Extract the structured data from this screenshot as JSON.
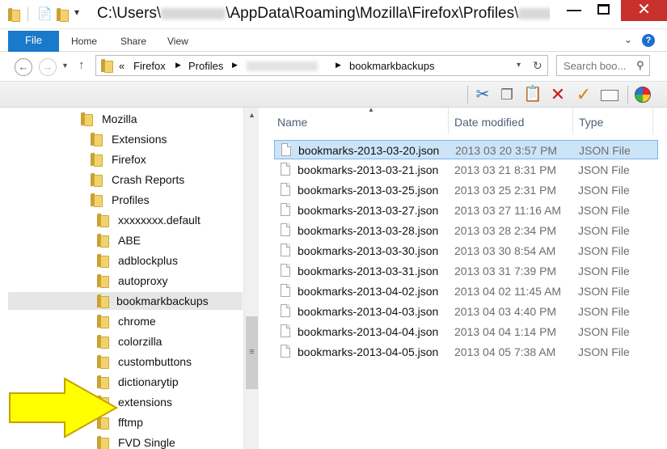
{
  "window": {
    "title": "C:\\Users\\",
    "title_rest": "\\AppData\\Roaming\\Mozilla\\Firefox\\Profiles\\",
    "close_glyph": "✕",
    "minimize_glyph": "—",
    "maximize_glyph": "☐"
  },
  "ribbon": {
    "file": "File",
    "home": "Home",
    "share": "Share",
    "view": "View",
    "help": "?"
  },
  "address": {
    "crumb_prefix": "«",
    "crumbs": [
      "Firefox",
      "Profiles",
      "bookmarkbackups"
    ],
    "search_placeholder": "Search boo..."
  },
  "toolbar": {
    "icons": [
      "cut-icon",
      "copy-icon",
      "paste-icon",
      "delete-icon",
      "checkmark-icon",
      "rename-icon",
      "color-wheel-icon"
    ]
  },
  "tree": {
    "items": [
      {
        "label": "Mozilla",
        "indent": 0
      },
      {
        "label": "Extensions",
        "indent": 1
      },
      {
        "label": "Firefox",
        "indent": 1
      },
      {
        "label": "Crash Reports",
        "indent": 2
      },
      {
        "label": "Profiles",
        "indent": 2
      },
      {
        "label": "xxxxxxxx.default",
        "indent": 3
      },
      {
        "label": "ABE",
        "indent": 4
      },
      {
        "label": "adblockplus",
        "indent": 4
      },
      {
        "label": "autoproxy",
        "indent": 4
      },
      {
        "label": "bookmarkbackups",
        "indent": 4,
        "selected": true
      },
      {
        "label": "chrome",
        "indent": 4
      },
      {
        "label": "colorzilla",
        "indent": 4
      },
      {
        "label": "custombuttons",
        "indent": 4
      },
      {
        "label": "dictionarytip",
        "indent": 4
      },
      {
        "label": "extensions",
        "indent": 4
      },
      {
        "label": "fftmp",
        "indent": 4
      },
      {
        "label": "FVD Single",
        "indent": 4
      }
    ]
  },
  "details": {
    "columns": [
      "Name",
      "Date modified",
      "Type"
    ],
    "rows": [
      {
        "name": "bookmarks-2013-03-20.json",
        "date": "2013 03 20 3:57 PM",
        "type": "JSON File",
        "selected": true
      },
      {
        "name": "bookmarks-2013-03-21.json",
        "date": "2013 03 21 8:31 PM",
        "type": "JSON File"
      },
      {
        "name": "bookmarks-2013-03-25.json",
        "date": "2013 03 25 2:31 PM",
        "type": "JSON File"
      },
      {
        "name": "bookmarks-2013-03-27.json",
        "date": "2013 03 27 11:16 AM",
        "type": "JSON File"
      },
      {
        "name": "bookmarks-2013-03-28.json",
        "date": "2013 03 28 2:34 PM",
        "type": "JSON File"
      },
      {
        "name": "bookmarks-2013-03-30.json",
        "date": "2013 03 30 8:54 AM",
        "type": "JSON File"
      },
      {
        "name": "bookmarks-2013-03-31.json",
        "date": "2013 03 31 7:39 PM",
        "type": "JSON File"
      },
      {
        "name": "bookmarks-2013-04-02.json",
        "date": "2013 04 02 11:45 AM",
        "type": "JSON File"
      },
      {
        "name": "bookmarks-2013-04-03.json",
        "date": "2013 04 03 4:40 PM",
        "type": "JSON File"
      },
      {
        "name": "bookmarks-2013-04-04.json",
        "date": "2013 04 04 1:14 PM",
        "type": "JSON File"
      },
      {
        "name": "bookmarks-2013-04-05.json",
        "date": "2013 04 05 7:38 AM",
        "type": "JSON File"
      }
    ]
  },
  "colors": {
    "accent": "#1979ca",
    "selection": "#cce4f7",
    "close": "#c7302c",
    "arrow_fill": "#ffff00",
    "arrow_stroke": "#c8a000"
  }
}
